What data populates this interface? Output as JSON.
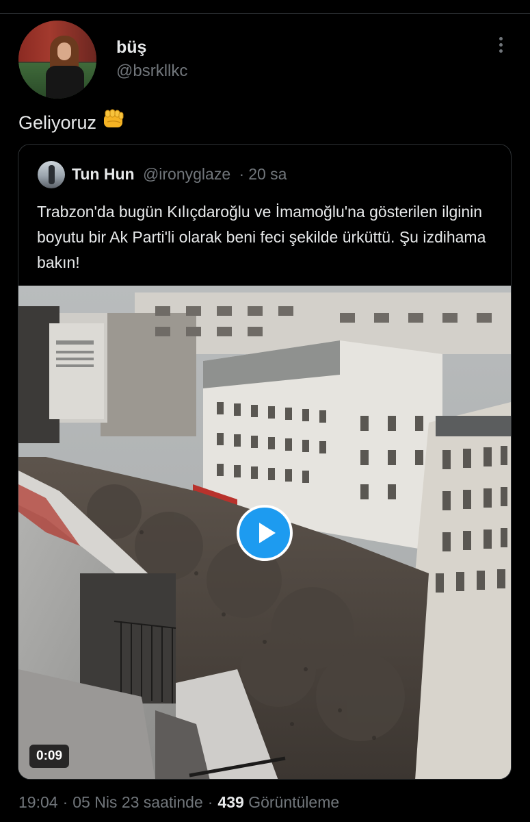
{
  "tweet": {
    "author_name": "büş",
    "author_handle": "@bsrkllkc",
    "text": "Geliyoruz",
    "emoji_icon": "oncoming-fist-icon",
    "more_icon": "more-vertical-icon"
  },
  "quoted_tweet": {
    "author_name": "Tun Hun",
    "author_handle": "@ironyglaze",
    "separator": "·",
    "time": "20 sa",
    "text": "Trabzon'da bugün Kılıçdaroğlu ve İmamoğlu'na gösterilen ilginin boyutu bir Ak Parti'li olarak beni feci şekilde ürküttü. Şu izdihama bakın!",
    "video": {
      "duration": "0:09",
      "play_icon": "play-icon"
    }
  },
  "meta": {
    "time": "19:04",
    "date": "05 Nis 23 saatinde",
    "separator": "·",
    "views_count": "439",
    "views_label": "Görüntüleme"
  },
  "colors": {
    "background": "#000000",
    "text_primary": "#e7e9ea",
    "text_secondary": "#71767b",
    "border": "#2f3336",
    "accent": "#1d9bf0"
  }
}
